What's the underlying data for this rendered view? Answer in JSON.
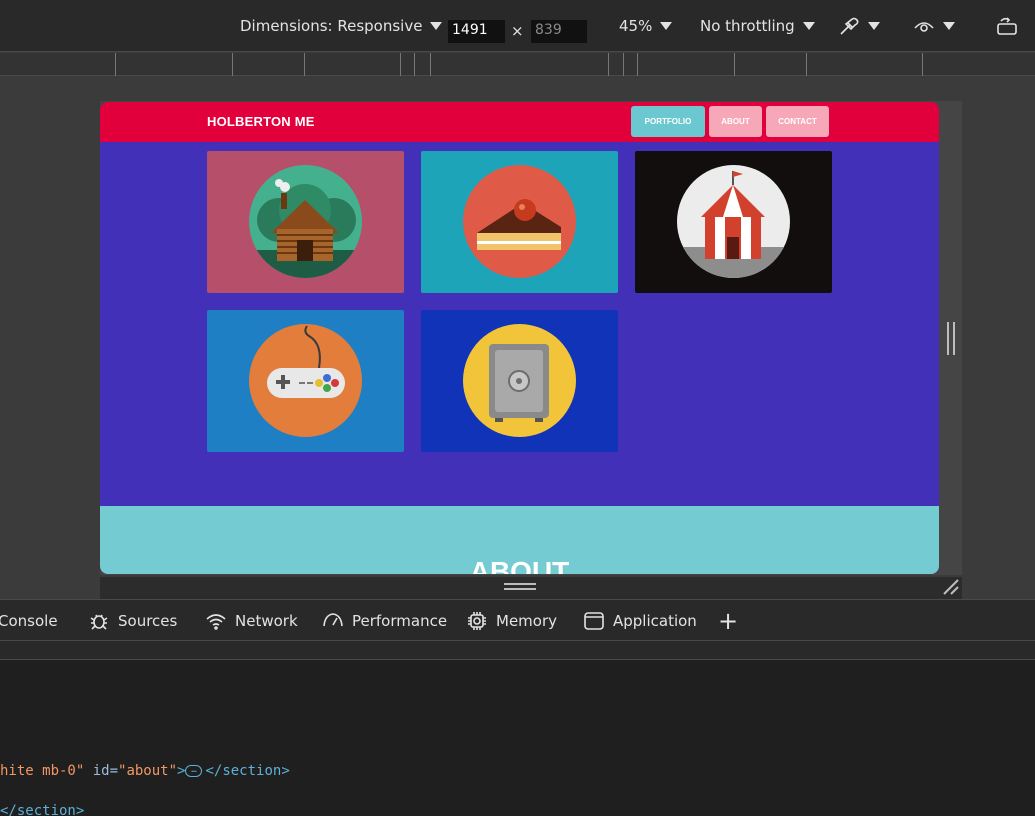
{
  "toolbar": {
    "dimensions_label": "Dimensions: Responsive",
    "width_value": "1491",
    "height_placeholder": "839",
    "times_symbol": "×",
    "zoom": "45%",
    "throttling": "No throttling"
  },
  "site": {
    "brand": "HOLBERTON ME",
    "nav": [
      {
        "label": "PORTFOLIO",
        "color": "#6cc8d0"
      },
      {
        "label": "ABOUT",
        "color": "#f7a8b8"
      },
      {
        "label": "CONTACT",
        "color": "#f7a8b8"
      }
    ],
    "colors": {
      "header": "#e1003c",
      "body": "#4330b8",
      "about": "#74cbd1"
    },
    "portfolio": [
      {
        "name": "log-cabin",
        "tile_color": "#b64f6a",
        "disc_color": "#45b08e"
      },
      {
        "name": "cake-slice",
        "tile_color": "#1ea4b8",
        "disc_color": "#e05b47"
      },
      {
        "name": "circus-tent",
        "tile_color": "#120e0e",
        "disc_color": "#ececec"
      },
      {
        "name": "game-controller",
        "tile_color": "#1f7fc4",
        "disc_color": "#e27d3c"
      },
      {
        "name": "safe",
        "tile_color": "#1033b8",
        "disc_color": "#f2c43a"
      }
    ],
    "about_title": "ABOUT"
  },
  "panel": {
    "tabs": [
      "Console",
      "Sources",
      "Network",
      "Performance",
      "Memory",
      "Application"
    ],
    "add_tab": "+"
  },
  "code": {
    "line1_attr_tail": "hite mb-0\"",
    "line1_id_attr": " id=",
    "line1_id_val": "\"about\"",
    "line1_gt": ">",
    "line1_ellipsis": "…",
    "line1_close": "</section>",
    "line2_close": "</section>"
  }
}
